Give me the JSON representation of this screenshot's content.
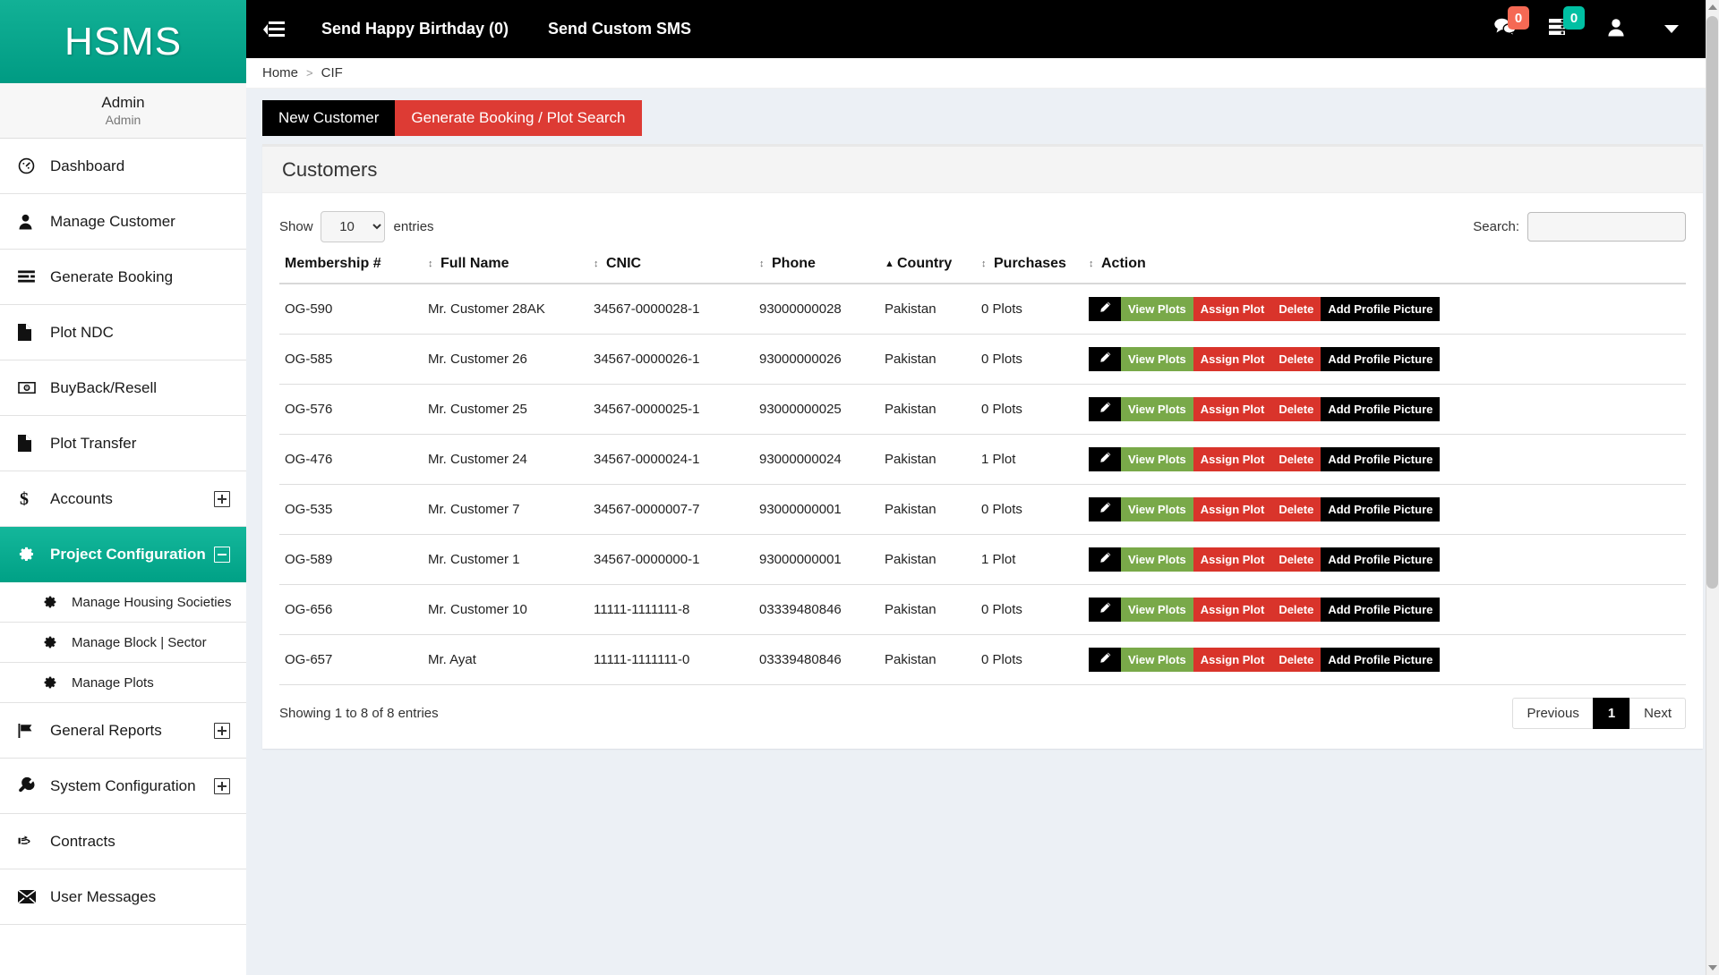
{
  "brand": {
    "title": "HSMS"
  },
  "user_panel": {
    "name": "Admin",
    "role": "Admin"
  },
  "sidebar": {
    "items": [
      {
        "label": "Dashboard",
        "icon": "dashboard-icon",
        "expand": ""
      },
      {
        "label": "Manage Customer",
        "icon": "user-icon",
        "expand": ""
      },
      {
        "label": "Generate Booking",
        "icon": "list-icon",
        "expand": ""
      },
      {
        "label": "Plot NDC",
        "icon": "file-icon",
        "expand": ""
      },
      {
        "label": "BuyBack/Resell",
        "icon": "money-icon",
        "expand": ""
      },
      {
        "label": "Plot Transfer",
        "icon": "file-icon",
        "expand": ""
      },
      {
        "label": "Accounts",
        "icon": "dollar-icon",
        "expand": "plus"
      },
      {
        "label": "Project Configuration",
        "icon": "gear-icon",
        "expand": "minus",
        "active": true
      },
      {
        "label": "Manage Housing Societies",
        "icon": "gear-icon",
        "sub": true
      },
      {
        "label": "Manage Block | Sector",
        "icon": "gear-icon",
        "sub": true
      },
      {
        "label": "Manage Plots",
        "icon": "gear-icon",
        "sub": true
      },
      {
        "label": "General Reports",
        "icon": "flag-icon",
        "expand": "plus"
      },
      {
        "label": "System Configuration",
        "icon": "wrench-icon",
        "expand": "plus"
      },
      {
        "label": "Contracts",
        "icon": "hand-pointer-icon",
        "expand": ""
      },
      {
        "label": "User Messages",
        "icon": "envelope-icon",
        "expand": ""
      }
    ]
  },
  "topbar": {
    "toggle_icon": "sidebar-toggle-icon",
    "links": [
      {
        "label": "Send Happy Birthday (0)"
      },
      {
        "label": "Send Custom SMS"
      }
    ],
    "icons": [
      {
        "name": "chat-icon",
        "badge": "0",
        "badge_color": "#f56954"
      },
      {
        "name": "tasks-icon",
        "badge": "0",
        "badge_color": "#00c0a3"
      },
      {
        "name": "user-icon",
        "badge": ""
      },
      {
        "name": "chevron-down-icon",
        "badge": ""
      }
    ]
  },
  "breadcrumb": {
    "home": "Home",
    "separator": ">",
    "current": "CIF"
  },
  "tabs": [
    {
      "label": "New Customer",
      "style": "black"
    },
    {
      "label": "Generate Booking / Plot Search",
      "style": "red"
    }
  ],
  "panel": {
    "title": "Customers"
  },
  "datatable": {
    "length_label_pre": "Show",
    "length_value": "10",
    "length_label_post": "entries",
    "search_label": "Search:",
    "search_value": "",
    "search_placeholder": "",
    "columns": [
      {
        "label": "Membership #",
        "sort": "none"
      },
      {
        "label": "Full Name",
        "sort": "none"
      },
      {
        "label": "CNIC",
        "sort": "none"
      },
      {
        "label": "Phone",
        "sort": "none"
      },
      {
        "label": "Country",
        "sort": "asc"
      },
      {
        "label": "Purchases",
        "sort": "none"
      },
      {
        "label": "Action",
        "sort": "none"
      }
    ],
    "rows": [
      {
        "membership": "OG-590",
        "name": "Mr. Customer 28AK",
        "cnic": "34567-0000028-1",
        "phone": "93000000028",
        "country": "Pakistan",
        "purchases": "0 Plots"
      },
      {
        "membership": "OG-585",
        "name": "Mr. Customer 26",
        "cnic": "34567-0000026-1",
        "phone": "93000000026",
        "country": "Pakistan",
        "purchases": "0 Plots"
      },
      {
        "membership": "OG-576",
        "name": "Mr. Customer 25",
        "cnic": "34567-0000025-1",
        "phone": "93000000025",
        "country": "Pakistan",
        "purchases": "0 Plots"
      },
      {
        "membership": "OG-476",
        "name": "Mr. Customer 24",
        "cnic": "34567-0000024-1",
        "phone": "93000000024",
        "country": "Pakistan",
        "purchases": "1 Plot"
      },
      {
        "membership": "OG-535",
        "name": "Mr. Customer 7",
        "cnic": "34567-0000007-7",
        "phone": "93000000001",
        "country": "Pakistan",
        "purchases": "0 Plots"
      },
      {
        "membership": "OG-589",
        "name": "Mr. Customer 1",
        "cnic": "34567-0000000-1",
        "phone": "93000000001",
        "country": "Pakistan",
        "purchases": "1 Plot"
      },
      {
        "membership": "OG-656",
        "name": "Mr. Customer 10",
        "cnic": "11111-1111111-8",
        "phone": "03339480846",
        "country": "Pakistan",
        "purchases": "0 Plots"
      },
      {
        "membership": "OG-657",
        "name": "Mr. Ayat",
        "cnic": "11111-1111111-0",
        "phone": "03339480846",
        "country": "Pakistan",
        "purchases": "0 Plots"
      }
    ],
    "actions": [
      {
        "label": "",
        "name": "edit-button",
        "style": "edit",
        "icon": "pencil-icon"
      },
      {
        "label": "View Plots",
        "name": "view-plots-button",
        "style": "view"
      },
      {
        "label": "Assign Plot",
        "name": "assign-plot-button",
        "style": "assign"
      },
      {
        "label": "Delete",
        "name": "delete-button",
        "style": "delete"
      },
      {
        "label": "Add Profile Picture",
        "name": "add-profile-picture-button",
        "style": "profile"
      }
    ],
    "info": "Showing 1 to 8 of 8 entries",
    "pagination": {
      "previous": "Previous",
      "current_page": "1",
      "next": "Next"
    }
  },
  "colors": {
    "brand_teal": "#00a28a",
    "topbar_black": "#000000",
    "danger_red": "#dd3b34",
    "success_green": "#79a949",
    "badge_red": "#f56954",
    "badge_teal": "#00c0a3",
    "page_bg": "#ecf0f5"
  }
}
